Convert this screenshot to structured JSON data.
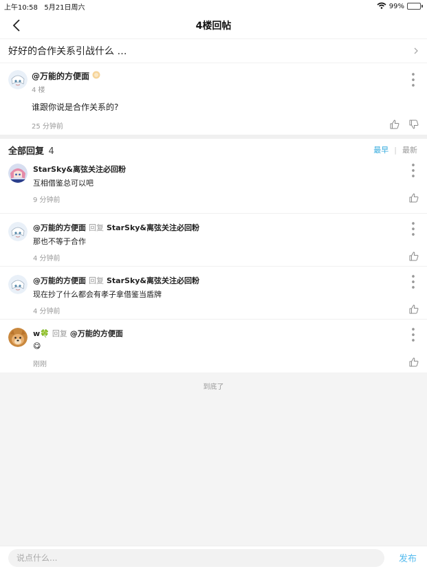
{
  "status": {
    "time_date": "上午10:58   5月21日周六",
    "battery": "99%",
    "battery_level": 0.99
  },
  "nav": {
    "title": "4楼回帖"
  },
  "thread": {
    "title": "好好的合作关系引战什么 …"
  },
  "op": {
    "name": "@万能的方便面",
    "floor": "4 楼",
    "content": "谁跟你说是合作关系的?",
    "time": "25 分钟前"
  },
  "replies": {
    "title": "全部回复",
    "count": "4",
    "sort_earliest": "最早",
    "sort_sep": "|",
    "sort_latest": "最新",
    "items": [
      {
        "name": "StarSky&离弦关注必回粉",
        "reply_word": "",
        "target": "",
        "text": "互相借鉴总可以吧",
        "time": "9 分钟前",
        "avatar": "anime-avatar-pink"
      },
      {
        "name": "@万能的方便面",
        "reply_word": "回复",
        "target": "StarSky&离弦关注必回粉",
        "text": "那也不等于合作",
        "time": "4 分钟前",
        "avatar": "anime-avatar-white"
      },
      {
        "name": "@万能的方便面",
        "reply_word": "回复",
        "target": "StarSky&离弦关注必回粉",
        "text": "现在抄了什么都会有孝子拿借鉴当盾牌",
        "time": "4 分钟前",
        "avatar": "anime-avatar-white"
      },
      {
        "name": "w🍀",
        "reply_word": "回复",
        "target": "@万能的方便面",
        "text": "😋",
        "time": "刚刚",
        "avatar": "dog-avatar"
      }
    ]
  },
  "end_text": "到底了",
  "composer": {
    "placeholder": "说点什么...",
    "publish": "发布"
  },
  "colors": {
    "accent": "#33aadd",
    "publish": "#55bbee"
  }
}
